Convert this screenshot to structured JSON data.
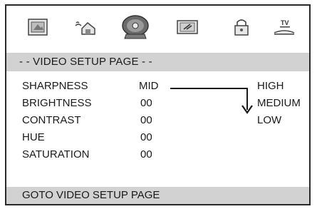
{
  "icons": [
    "general-setup-icon",
    "audio-speaker-icon",
    "video-disc-icon",
    "preference-icon",
    "password-lock-icon",
    "tv-display-icon"
  ],
  "header": {
    "title": "- - VIDEO SETUP PAGE - -"
  },
  "settings": [
    {
      "label": "SHARPNESS",
      "value": "MID"
    },
    {
      "label": "BRIGHTNESS",
      "value": "00"
    },
    {
      "label": "CONTRAST",
      "value": "00"
    },
    {
      "label": "HUE",
      "value": "00"
    },
    {
      "label": "SATURATION",
      "value": "00"
    }
  ],
  "sharpness_options": [
    "HIGH",
    "MEDIUM",
    "LOW"
  ],
  "footer": {
    "status": "GOTO VIDEO SETUP PAGE"
  },
  "colors": {
    "bar_gray": "#d2d2d2",
    "border": "#2a2a2a"
  }
}
